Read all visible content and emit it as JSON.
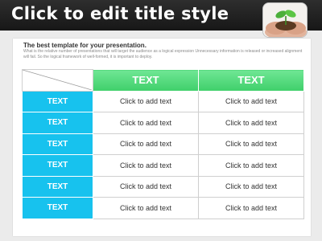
{
  "slide": {
    "title": "Click to edit title style",
    "subtitle": "The best template for your presentation.",
    "description": "What is the relative number of presentations that will target the audience as a logical expression Unnecessary information is released or increased alignment will fail. So the logical framework of well-formed, it is important to deploy."
  },
  "table": {
    "headers": [
      "TEXT",
      "TEXT"
    ],
    "rows": [
      {
        "label": "TEXT",
        "cells": [
          "Click to add text",
          "Click to add text"
        ]
      },
      {
        "label": "TEXT",
        "cells": [
          "Click to add text",
          "Click to add text"
        ]
      },
      {
        "label": "TEXT",
        "cells": [
          "Click to add text",
          "Click to add text"
        ]
      },
      {
        "label": "TEXT",
        "cells": [
          "Click to add text",
          "Click to add text"
        ]
      },
      {
        "label": "TEXT",
        "cells": [
          "Click to add text",
          "Click to add text"
        ]
      },
      {
        "label": "TEXT",
        "cells": [
          "Click to add text",
          "Click to add text"
        ]
      }
    ]
  },
  "colors": {
    "header_bar": "#1f1f1f",
    "column_header": "#4cd676",
    "row_header": "#17c2ee"
  },
  "icons": {
    "header_photo": "hands-holding-seedling-image"
  }
}
